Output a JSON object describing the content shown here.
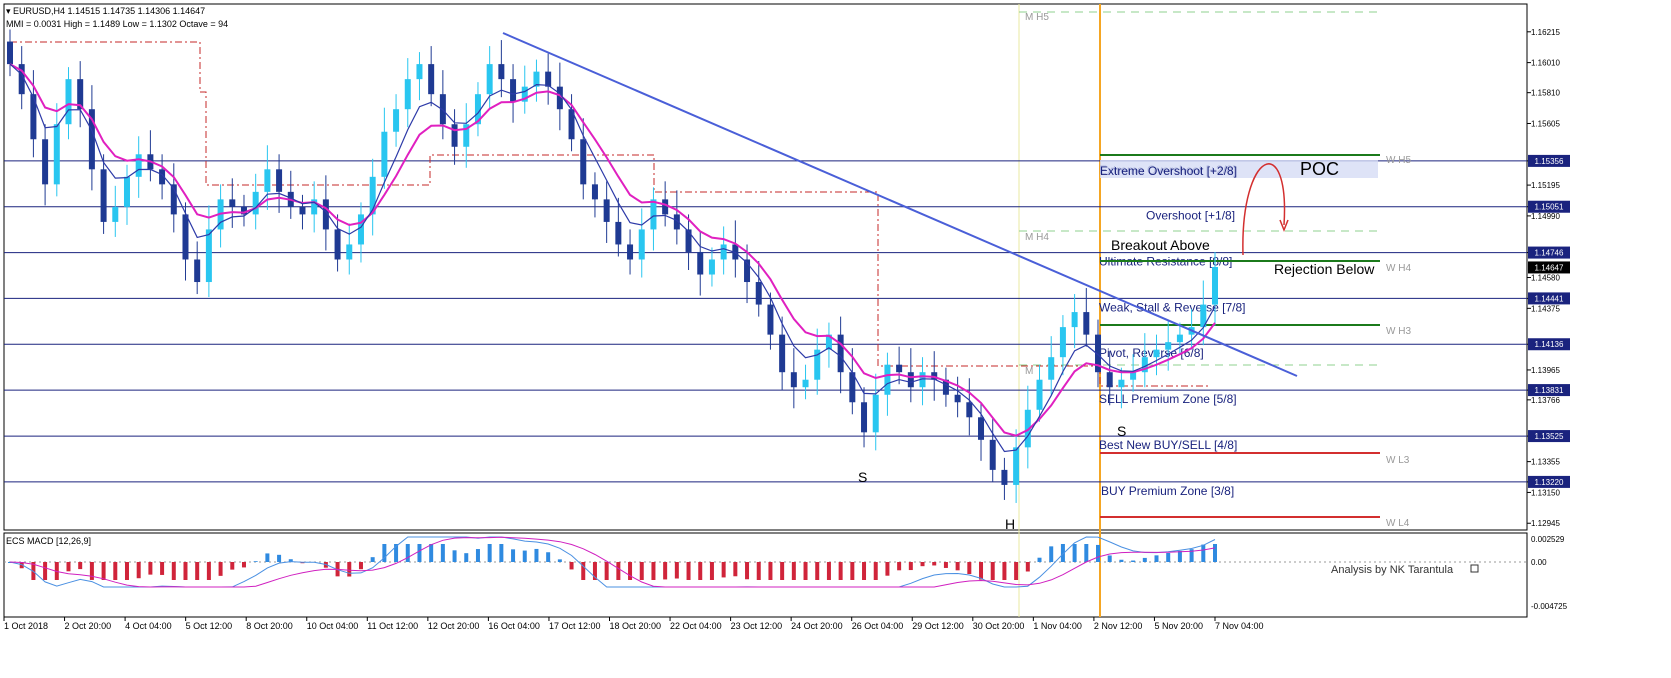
{
  "chart_data": {
    "type": "candlestick",
    "symbol_header": "EURUSD,H4  1.14515 1.14735 1.14306 1.14647",
    "mmi_header": "MMI = 0.0031  High = 1.1489  Low = 1.1302  Octave = 94",
    "current_price": 1.14647,
    "price_range": [
      1.129,
      1.164
    ],
    "price_ticks": [
      1.16215,
      1.1601,
      1.1581,
      1.15605,
      1.15356,
      1.15195,
      1.15051,
      1.1499,
      1.14746,
      1.1458,
      1.14441,
      1.14375,
      1.14136,
      1.13965,
      1.13831,
      1.13766,
      1.13525,
      1.13355,
      1.1322,
      1.1315,
      1.12945
    ],
    "boxed_price_labels": [
      "1.15356",
      "1.15051",
      "1.14746",
      "1.14647",
      "1.14441",
      "1.14136",
      "1.13831",
      "1.13525",
      "1.13220"
    ],
    "time_ticks": [
      "1 Oct 2018",
      "2 Oct 20:00",
      "4 Oct 04:00",
      "5 Oct 12:00",
      "8 Oct 20:00",
      "10 Oct 04:00",
      "11 Oct 12:00",
      "12 Oct 20:00",
      "16 Oct 04:00",
      "17 Oct 12:00",
      "18 Oct 20:00",
      "22 Oct 04:00",
      "23 Oct 12:00",
      "24 Oct 20:00",
      "26 Oct 04:00",
      "29 Oct 12:00",
      "30 Oct 20:00",
      "1 Nov 04:00",
      "2 Nov 12:00",
      "5 Nov 20:00",
      "7 Nov 04:00"
    ],
    "murrey_levels": [
      {
        "price": 1.15356,
        "label": "Extreme Overshoot [+2/8]",
        "side": "W H5"
      },
      {
        "price": 1.15051,
        "label": "Overshoot [+1/8]",
        "side": ""
      },
      {
        "price": 1.14746,
        "label": "Ultimate Resistance [8/8]",
        "side": "W H4"
      },
      {
        "price": 1.14441,
        "label": "Weak, Stall & Reverse [7/8]",
        "side": ""
      },
      {
        "price": 1.14136,
        "label": "Pivot, Reverse [6/8]",
        "side": ""
      },
      {
        "price": 1.13831,
        "label": "SELL Premium Zone [5/8]",
        "side": ""
      },
      {
        "price": 1.13525,
        "label": "Best New BUY/SELL [4/8]",
        "side": ""
      },
      {
        "price": 1.1322,
        "label": "BUY Premium Zone [3/8]",
        "side": ""
      }
    ],
    "side_labels": [
      "W H5",
      "W H4",
      "W H3",
      "W L3",
      "W L4"
    ],
    "m_labels": [
      "M H5",
      "M H4",
      "M"
    ],
    "annotations": {
      "poc": "POC",
      "breakout": "Breakout Above",
      "rejection": "Rejection Below",
      "shoulder_left": "S",
      "shoulder_right": "S",
      "head": "H"
    },
    "closes": [
      1.16,
      1.158,
      1.155,
      1.152,
      1.156,
      1.159,
      1.157,
      1.153,
      1.1495,
      1.1505,
      1.1525,
      1.154,
      1.153,
      1.152,
      1.15,
      1.147,
      1.1455,
      1.149,
      1.151,
      1.1505,
      1.15,
      1.1515,
      1.153,
      1.1515,
      1.1505,
      1.15,
      1.151,
      1.149,
      1.147,
      1.148,
      1.15,
      1.1525,
      1.1555,
      1.157,
      1.159,
      1.16,
      1.158,
      1.156,
      1.1545,
      1.156,
      1.158,
      1.16,
      1.159,
      1.1575,
      1.1585,
      1.1595,
      1.1585,
      1.157,
      1.155,
      1.152,
      1.151,
      1.1495,
      1.148,
      1.147,
      1.149,
      1.151,
      1.15,
      1.149,
      1.1475,
      1.146,
      1.147,
      1.148,
      1.147,
      1.1455,
      1.144,
      1.142,
      1.1395,
      1.1385,
      1.139,
      1.141,
      1.142,
      1.1395,
      1.1375,
      1.1355,
      1.138,
      1.14,
      1.1395,
      1.1385,
      1.1395,
      1.139,
      1.138,
      1.1375,
      1.1365,
      1.135,
      1.133,
      1.132,
      1.1345,
      1.137,
      1.139,
      1.1405,
      1.1425,
      1.1435,
      1.142,
      1.1395,
      1.1385,
      1.139,
      1.1395,
      1.1405,
      1.141,
      1.1415,
      1.142,
      1.1425,
      1.144,
      1.1465
    ],
    "macd_indicator": "ECS MACD [12,26,9]",
    "macd_ticks": [
      0.002529,
      0.0,
      -0.004725
    ],
    "credit": "Analysis by NK Tarantula"
  }
}
